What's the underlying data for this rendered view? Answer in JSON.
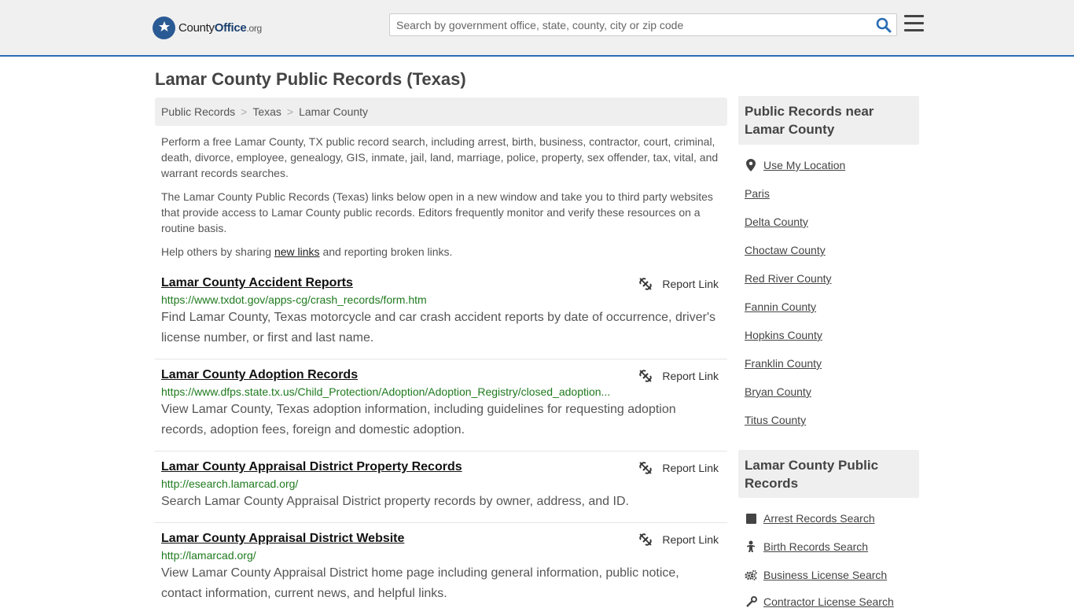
{
  "header": {
    "logo_main": "County",
    "logo_bold": "Office",
    "logo_tld": ".org",
    "search_placeholder": "Search by government office, state, county, city or zip code"
  },
  "page": {
    "title": "Lamar County Public Records (Texas)"
  },
  "breadcrumb": {
    "items": [
      "Public Records",
      "Texas",
      "Lamar County"
    ]
  },
  "intro": {
    "p1": "Perform a free Lamar County, TX public record search, including arrest, birth, business, contractor, court, criminal, death, divorce, employee, genealogy, GIS, inmate, jail, land, marriage, police, property, sex offender, tax, vital, and warrant records searches.",
    "p2": "The Lamar County Public Records (Texas) links below open in a new window and take you to third party websites that provide access to Lamar County public records. Editors frequently monitor and verify these resources on a routine basis.",
    "p3_before": "Help others by sharing ",
    "p3_link": "new links",
    "p3_after": " and reporting broken links."
  },
  "records": [
    {
      "title": "Lamar County Accident Reports",
      "url": "https://www.txdot.gov/apps-cg/crash_records/form.htm",
      "desc": "Find Lamar County, Texas motorcycle and car crash accident reports by date of occurrence, driver's license number, or first and last name.",
      "report": "Report Link"
    },
    {
      "title": "Lamar County Adoption Records",
      "url": "https://www.dfps.state.tx.us/Child_Protection/Adoption/Adoption_Registry/closed_adoption...",
      "desc": "View Lamar County, Texas adoption information, including guidelines for requesting adoption records, adoption fees, foreign and domestic adoption.",
      "report": "Report Link"
    },
    {
      "title": "Lamar County Appraisal District Property Records",
      "url": "http://esearch.lamarcad.org/",
      "desc": "Search Lamar County Appraisal District property records by owner, address, and ID.",
      "report": "Report Link"
    },
    {
      "title": "Lamar County Appraisal District Website",
      "url": "http://lamarcad.org/",
      "desc": "View Lamar County Appraisal District home page including general information, public notice, contact information, current news, and helpful links.",
      "report": "Report Link"
    }
  ],
  "sidebar": {
    "nearby_heading": "Public Records near Lamar County",
    "use_location": "Use My Location",
    "nearby": [
      "Paris",
      "Delta County",
      "Choctaw County",
      "Red River County",
      "Fannin County",
      "Hopkins County",
      "Franklin County",
      "Bryan County",
      "Titus County"
    ],
    "records_heading": "Lamar County Public Records",
    "record_links": [
      {
        "label": "Arrest Records Search",
        "icon": "square-icon"
      },
      {
        "label": "Birth Records Search",
        "icon": "baby-icon"
      },
      {
        "label": "Business License Search",
        "icon": "gears-icon"
      },
      {
        "label": "Contractor License Search",
        "icon": "tools-icon"
      }
    ]
  }
}
